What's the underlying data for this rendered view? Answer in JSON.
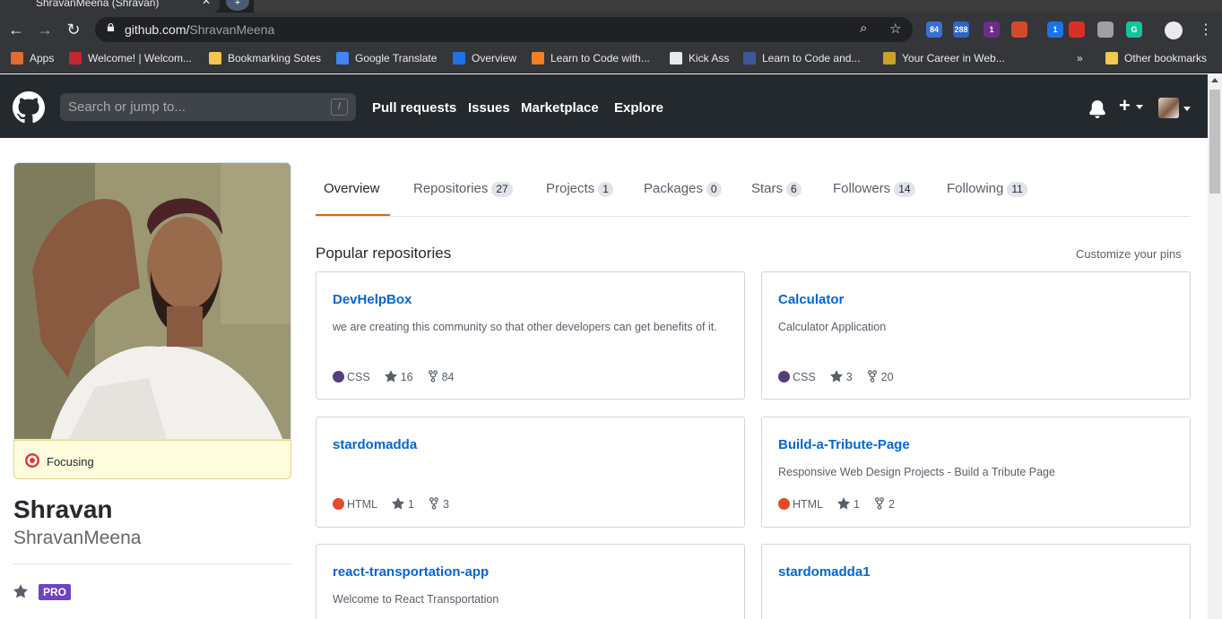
{
  "browser": {
    "tab_title": "ShravanMeena (Shravan)",
    "url_host": "github.com/",
    "url_path": "ShravanMeena",
    "extensions": [
      {
        "name": "ext-a",
        "badge": "84",
        "color": "#3b6fd4"
      },
      {
        "name": "ext-b",
        "badge": "288",
        "color": "#2c66c7"
      },
      {
        "name": "ext-c",
        "badge": "1",
        "color": "#6b2d8a"
      },
      {
        "name": "ext-d",
        "badge": "",
        "color": "#d14b2a"
      },
      {
        "name": "ext-e",
        "badge": "1",
        "color": "#1a73e8"
      },
      {
        "name": "ext-f",
        "badge": "",
        "color": "#d93025"
      },
      {
        "name": "ext-g",
        "badge": "",
        "color": "#a0a0a0"
      },
      {
        "name": "ext-h",
        "badge": "G",
        "color": "#15c39a"
      }
    ]
  },
  "bookmarks": [
    {
      "label": "Apps",
      "color": "#e06c2e"
    },
    {
      "label": "Welcome! | Welcom...",
      "color": "#c1272d"
    },
    {
      "label": "Bookmarking Sotes",
      "color": "#f2c94c"
    },
    {
      "label": "Google Translate",
      "color": "#4285f4"
    },
    {
      "label": "Overview",
      "color": "#1a73e8"
    },
    {
      "label": "Learn to Code with...",
      "color": "#f48024"
    },
    {
      "label": "Kick Ass",
      "color": "#e8eaed"
    },
    {
      "label": "Learn to Code and...",
      "color": "#3b5998"
    },
    {
      "label": "Your Career in Web...",
      "color": "#c9a227"
    },
    {
      "label": "»",
      "color": ""
    },
    {
      "label": "Other bookmarks",
      "color": "#f2c94c"
    }
  ],
  "header": {
    "search_placeholder": "Search or jump to...",
    "search_shortcut": "/",
    "nav": [
      "Pull requests",
      "Issues",
      "Marketplace",
      "Explore"
    ],
    "plus": "+"
  },
  "profile": {
    "status": "Focusing",
    "fullname": "Shravan",
    "username": "ShravanMeena",
    "badge": "PRO"
  },
  "tabs": [
    {
      "label": "Overview",
      "count": ""
    },
    {
      "label": "Repositories",
      "count": "27"
    },
    {
      "label": "Projects",
      "count": "1"
    },
    {
      "label": "Packages",
      "count": "0"
    },
    {
      "label": "Stars",
      "count": "6"
    },
    {
      "label": "Followers",
      "count": "14"
    },
    {
      "label": "Following",
      "count": "11"
    }
  ],
  "popular": {
    "title": "Popular repositories",
    "customize": "Customize your pins",
    "repos": [
      {
        "name": "DevHelpBox",
        "desc": "we are creating this community so that other developers can get benefits of it.",
        "lang": "CSS",
        "lang_color": "#563d7c",
        "stars": "16",
        "forks": "84"
      },
      {
        "name": "Calculator",
        "desc": "Calculator Application",
        "lang": "CSS",
        "lang_color": "#563d7c",
        "stars": "3",
        "forks": "20"
      },
      {
        "name": "stardomadda",
        "desc": "",
        "lang": "HTML",
        "lang_color": "#e34c26",
        "stars": "1",
        "forks": "3"
      },
      {
        "name": "Build-a-Tribute-Page",
        "desc": "Responsive Web Design Projects - Build a Tribute Page",
        "lang": "HTML",
        "lang_color": "#e34c26",
        "stars": "1",
        "forks": "2"
      },
      {
        "name": "react-transportation-app",
        "desc": "Welcome to React Transportation",
        "lang": "",
        "lang_color": "",
        "stars": "",
        "forks": ""
      },
      {
        "name": "stardomadda1",
        "desc": "",
        "lang": "",
        "lang_color": "",
        "stars": "",
        "forks": ""
      }
    ]
  }
}
